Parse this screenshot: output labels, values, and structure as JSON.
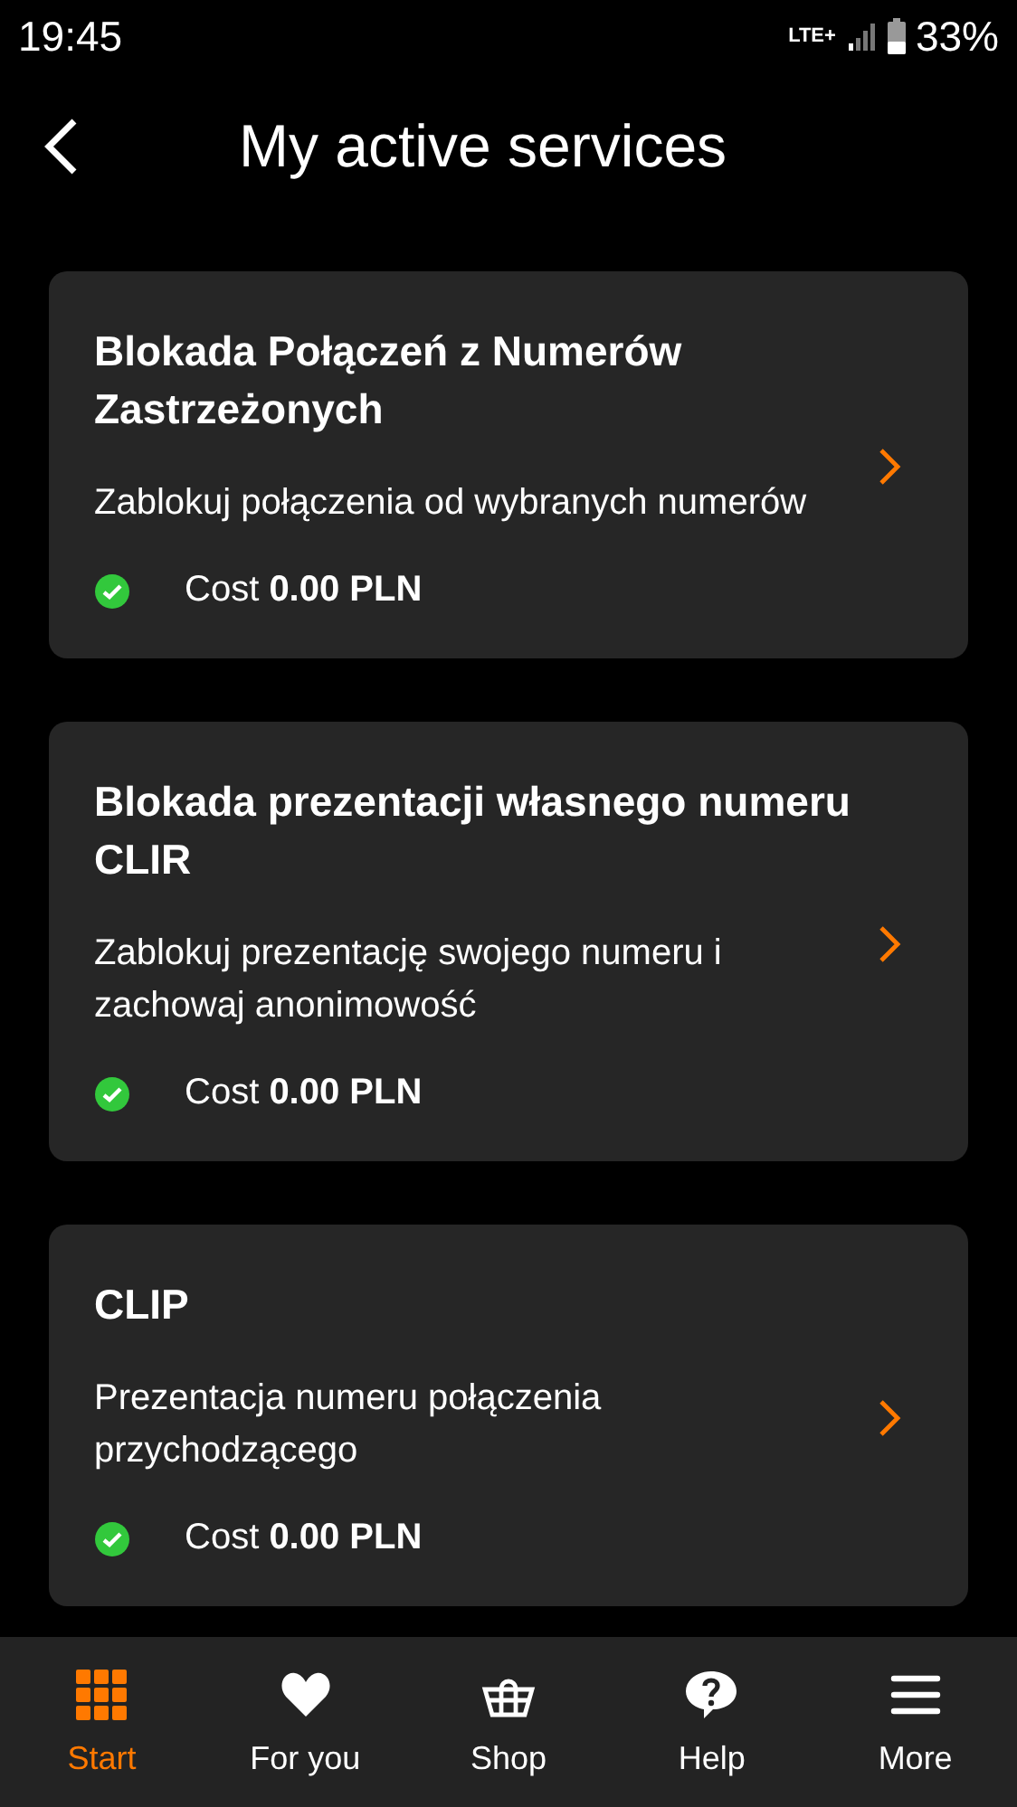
{
  "status_bar": {
    "time": "19:45",
    "network": "LTE+",
    "battery": "33%"
  },
  "header": {
    "title": "My active services"
  },
  "services": [
    {
      "title": "Blokada Połączeń z Numerów Zastrzeżonych",
      "description": "Zablokuj połączenia od wybranych numerów",
      "cost": "Cost **0.00 PLN**",
      "active": true
    },
    {
      "title": "Blokada prezentacji własnego numeru CLIR",
      "description": "Zablokuj prezentację swojego numeru i zachowaj anonimowość",
      "cost": "Cost **0.00 PLN**",
      "active": true
    },
    {
      "title": "CLIP",
      "description": "Prezentacja numeru połączenia przychodzącego",
      "cost": "Cost **0.00 PLN**",
      "active": true
    }
  ],
  "bottom_nav": [
    {
      "kind": "grid",
      "label": "Start",
      "selected": true
    },
    {
      "kind": "heart",
      "label": "For you",
      "selected": false
    },
    {
      "kind": "basket",
      "label": "Shop",
      "selected": false
    },
    {
      "kind": "help",
      "label": "Help",
      "selected": false
    },
    {
      "kind": "menu",
      "label": "More",
      "selected": false
    }
  ]
}
